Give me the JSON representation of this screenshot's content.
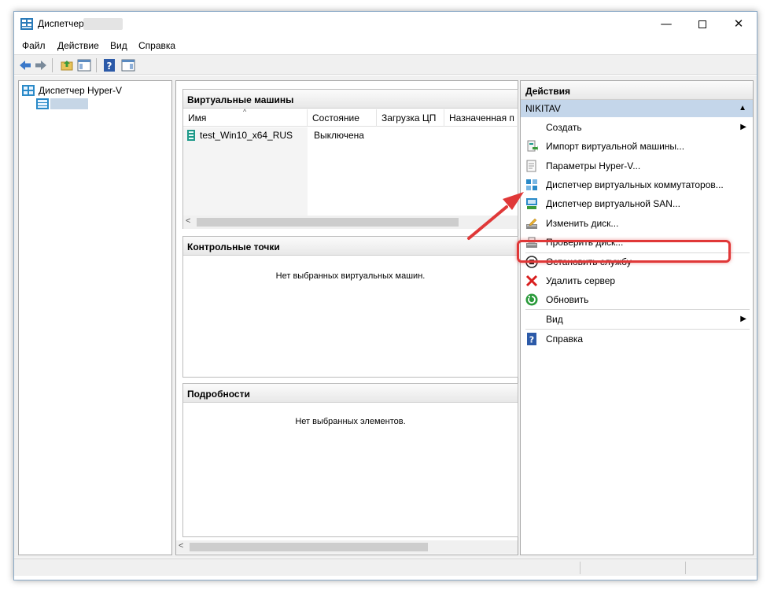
{
  "window": {
    "title": "Диспетчер",
    "controls": {
      "minimize": "—",
      "close": "✕"
    }
  },
  "menu": [
    "Файл",
    "Действие",
    "Вид",
    "Справка"
  ],
  "tree": {
    "root": "Диспетчер Hyper-V"
  },
  "vm_section": {
    "title": "Виртуальные машины",
    "columns": [
      "Имя",
      "Состояние",
      "Загрузка ЦП",
      "Назначенная п"
    ],
    "rows": [
      {
        "name": "test_Win10_x64_RUS",
        "state": "Выключена"
      }
    ]
  },
  "checkpoints": {
    "title": "Контрольные точки",
    "empty": "Нет выбранных виртуальных машин."
  },
  "details": {
    "title": "Подробности",
    "empty": "Нет выбранных элементов."
  },
  "actions": {
    "title": "Действия",
    "group": "NIKITAV",
    "items": [
      {
        "label": "Создать",
        "icon": "blank-icon",
        "submenu": true
      },
      {
        "label": "Импорт виртуальной машины...",
        "icon": "import-vm-icon"
      },
      {
        "label": "Параметры Hyper-V...",
        "icon": "settings-document-icon"
      },
      {
        "label": "Диспетчер виртуальных коммутаторов...",
        "icon": "virtual-switch-icon"
      },
      {
        "label": "Диспетчер виртуальной SAN...",
        "icon": "virtual-san-icon"
      },
      {
        "label": "Изменить диск...",
        "icon": "edit-disk-icon"
      },
      {
        "label": "Проверить диск...",
        "icon": "inspect-disk-icon"
      },
      {
        "label": "Остановить службу",
        "icon": "stop-service-icon"
      },
      {
        "label": "Удалить сервер",
        "icon": "remove-server-icon"
      },
      {
        "label": "Обновить",
        "icon": "refresh-icon"
      },
      {
        "label": "Вид",
        "icon": "blank-icon",
        "submenu": true
      },
      {
        "label": "Справка",
        "icon": "help-icon"
      }
    ]
  },
  "colors": {
    "selection": "#c4d6ea",
    "highlight_red": "#e03838",
    "back_arrow": "#3a78c9"
  }
}
